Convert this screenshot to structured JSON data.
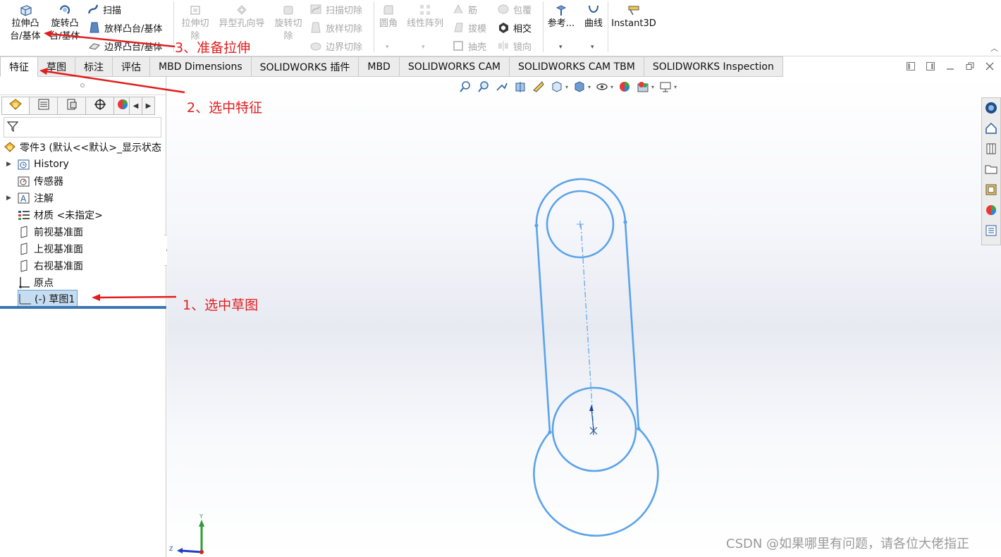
{
  "ribbon": {
    "extrude_boss": {
      "line1": "拉伸凸",
      "line2": "台/基体"
    },
    "revolve_boss": {
      "line1": "旋转凸",
      "line2": "台/基体"
    },
    "sweep": "扫描",
    "loft_boss": "放样凸台/基体",
    "boundary_boss": "边界凸台/基体",
    "extrude_cut": {
      "line1": "拉伸切",
      "line2": "除"
    },
    "hole_wizard": "异型孔向导",
    "revolve_cut": {
      "line1": "旋转切",
      "line2": "除"
    },
    "swept_cut": "扫描切除",
    "lofted_cut": "放样切除",
    "boundary_cut": "边界切除",
    "fillet": "圆角",
    "linear_pattern": "线性阵列",
    "rib": "筋",
    "draft": "拔模",
    "shell": "抽壳",
    "wrap": "包覆",
    "intersect": "相交",
    "mirror": "镜向",
    "reference": "参考...",
    "curves": "曲线",
    "instant3d": "Instant3D"
  },
  "tabs": [
    "特征",
    "草图",
    "标注",
    "评估",
    "MBD Dimensions",
    "SOLIDWORKS 插件",
    "MBD",
    "SOLIDWORKS CAM",
    "SOLIDWORKS CAM TBM",
    "SOLIDWORKS Inspection"
  ],
  "tree": {
    "part": "零件3  (默认<<默认>_显示状态",
    "history": "History",
    "sensors": "传感器",
    "annotations": "注解",
    "material": "材质 <未指定>",
    "front_plane": "前视基准面",
    "top_plane": "上视基准面",
    "right_plane": "右视基准面",
    "origin": "原点",
    "sketch": "(-) 草图1"
  },
  "triad": {
    "y": "Y",
    "z": "Z"
  },
  "annotations": {
    "step1": "1、选中草图",
    "step2": "2、选中特征",
    "step3": "3、准备拉伸"
  },
  "watermark": "CSDN @如果哪里有问题，请各位大佬指正",
  "colors": {
    "sketch": "#5aa3ec",
    "annotation": "#e11d1d",
    "selection": "#c5ddf1"
  }
}
